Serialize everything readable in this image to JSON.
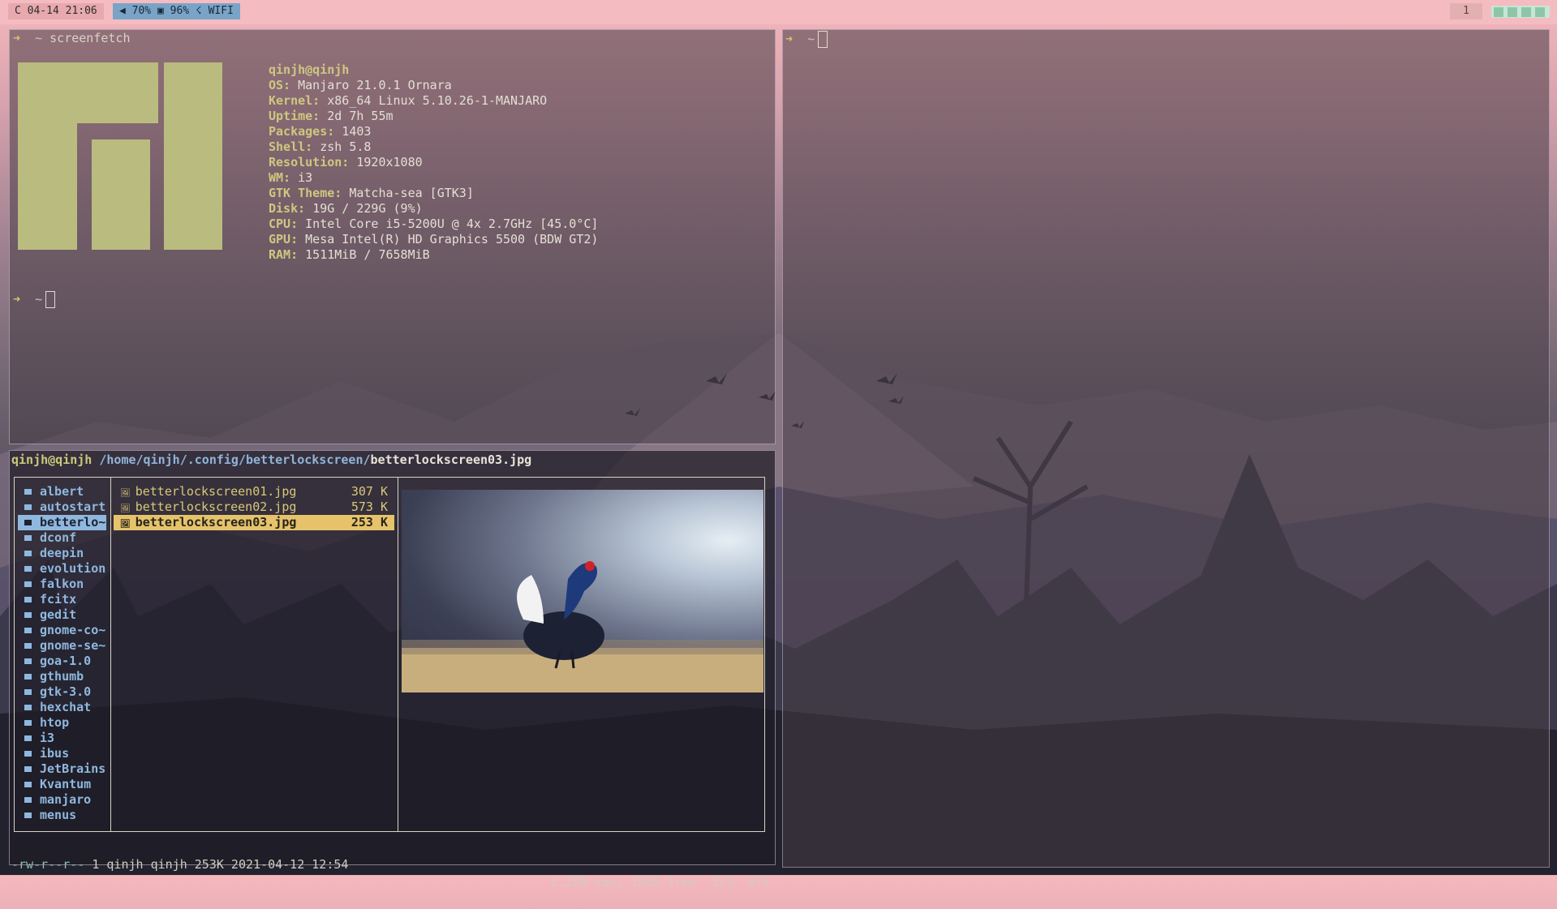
{
  "topbar": {
    "clock": "C 04-14 21:06",
    "volume": "◀ 70%",
    "battery": "▣ 96%",
    "wifi": "☇ WIFI",
    "workspace": "1"
  },
  "terminal_left": {
    "prompt_arrow": "➜",
    "prompt_dir": "~",
    "command": "screenfetch",
    "user_host": "qinjh@qinjh",
    "info": [
      {
        "key": "OS:",
        "value": "Manjaro 21.0.1 Ornara"
      },
      {
        "key": "Kernel:",
        "value": "x86_64 Linux 5.10.26-1-MANJARO"
      },
      {
        "key": "Uptime:",
        "value": "2d 7h 55m"
      },
      {
        "key": "Packages:",
        "value": "1403"
      },
      {
        "key": "Shell:",
        "value": "zsh 5.8"
      },
      {
        "key": "Resolution:",
        "value": "1920x1080"
      },
      {
        "key": "WM:",
        "value": "i3"
      },
      {
        "key": "GTK Theme:",
        "value": "Matcha-sea [GTK3]"
      },
      {
        "key": "Disk:",
        "value": "19G / 229G (9%)"
      },
      {
        "key": "CPU:",
        "value": "Intel Core i5-5200U @ 4x 2.7GHz [45.0°C]"
      },
      {
        "key": "GPU:",
        "value": "Mesa Intel(R) HD Graphics 5500 (BDW GT2)"
      },
      {
        "key": "RAM:",
        "value": "1511MiB / 7658MiB"
      }
    ],
    "second_prompt_dir": "~"
  },
  "terminal_right": {
    "prompt_arrow": "➜",
    "prompt_dir": "~"
  },
  "ranger": {
    "user_host": "qinjh@qinjh",
    "path": "/home/qinjh/.config/betterlockscreen/",
    "current_file": "betterlockscreen03.jpg",
    "dirs": [
      "albert",
      "autostart",
      "betterlo~",
      "dconf",
      "deepin",
      "evolution",
      "falkon",
      "fcitx",
      "gedit",
      "gnome-co~",
      "gnome-se~",
      "goa-1.0",
      "gthumb",
      "gtk-3.0",
      "hexchat",
      "htop",
      "i3",
      "ibus",
      "JetBrains",
      "Kvantum",
      "manjaro",
      "menus"
    ],
    "selected_dir_index": 2,
    "files": [
      {
        "name": "betterlockscreen01.jpg",
        "size": "307 K"
      },
      {
        "name": "betterlockscreen02.jpg",
        "size": "573 K"
      },
      {
        "name": "betterlockscreen03.jpg",
        "size": "253 K"
      }
    ],
    "selected_file_index": 2,
    "file_icon": "🖼",
    "status_perm": "-rw-r--r--",
    "status_info": " 1 qinjh qinjh 253K 2021-04-12 12:54",
    "status_right": "1.11M sum, 195G free  3/3  All"
  }
}
